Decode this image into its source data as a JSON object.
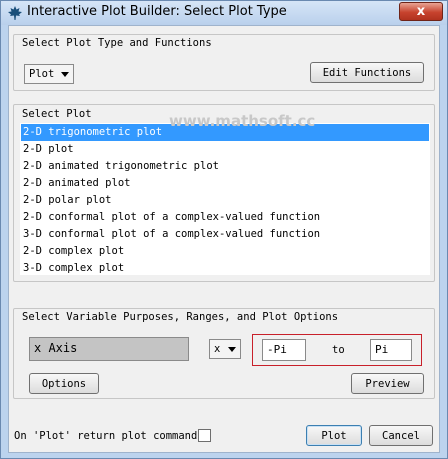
{
  "window": {
    "title": "Interactive Plot Builder: Select Plot Type",
    "close_symbol": "x"
  },
  "group_type": {
    "title": "Select Plot Type and Functions",
    "plot_combo_value": "Plot",
    "edit_functions_label": "Edit Functions"
  },
  "group_plot": {
    "title": "Select Plot",
    "items": [
      "2-D trigonometric plot",
      "2-D plot",
      "2-D animated trigonometric plot",
      "2-D animated plot",
      "2-D polar plot",
      "2-D conformal plot of a complex-valued function",
      "3-D conformal plot of a complex-valued function",
      "2-D complex plot",
      "3-D complex plot"
    ],
    "selected_index": 0
  },
  "watermark": "www.mathsoft.cc",
  "group_vars": {
    "title": "Select Variable Purposes, Ranges, and Plot Options",
    "axis_label": "x Axis",
    "var_combo_value": "x",
    "range_from": "-Pi",
    "range_to_label": "to",
    "range_to": "Pi",
    "options_label": "Options",
    "preview_label": "Preview"
  },
  "footer": {
    "return_command_label": "On 'Plot' return plot command",
    "return_command_checked": false,
    "plot_label": "Plot",
    "cancel_label": "Cancel"
  },
  "colors": {
    "selection": "#3399ff",
    "range_highlight": "#c8202a",
    "title_close": "#c7432e"
  }
}
